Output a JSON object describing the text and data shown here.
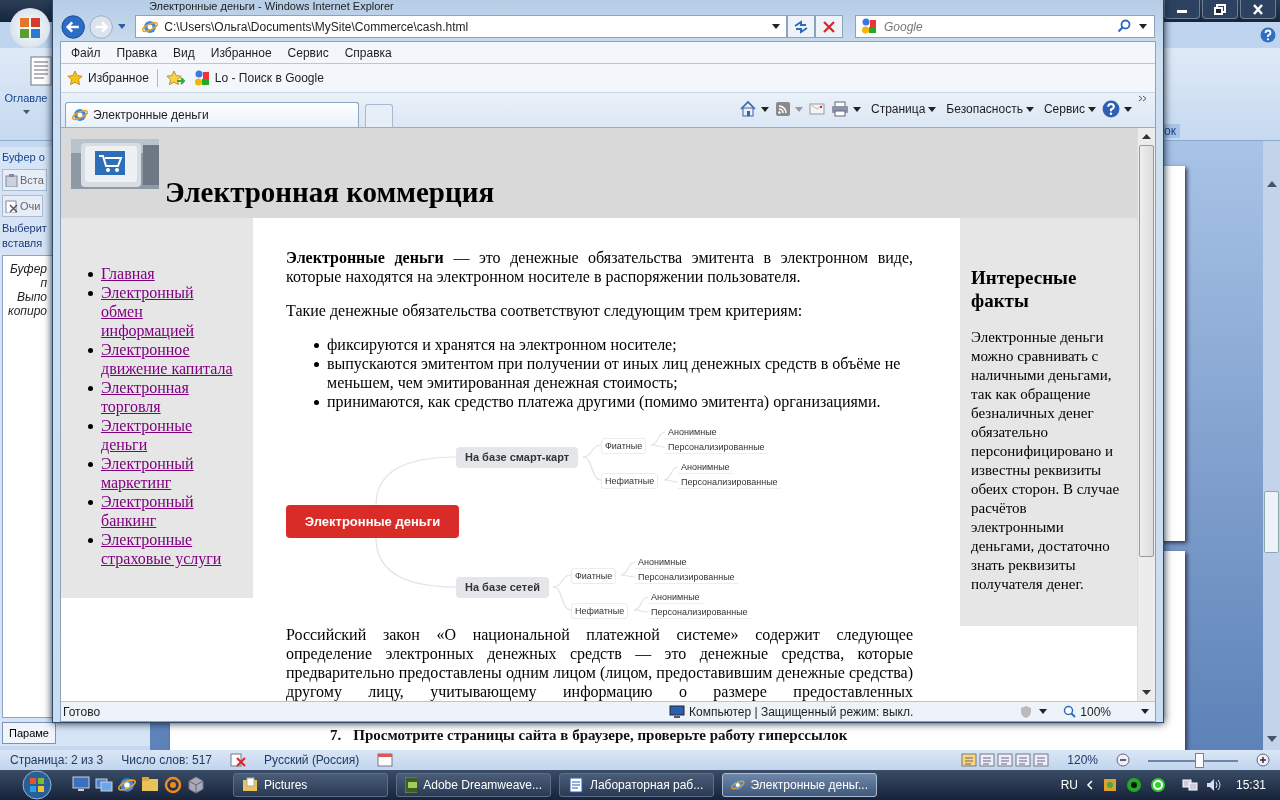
{
  "word": {
    "ribbon_group": "Оглавле",
    "ribbon_tail": "ок",
    "pane": {
      "title": "Буфер о",
      "paste": "Вста",
      "clear": "Очи",
      "hint": [
        "Выберит",
        "вставля"
      ],
      "notice": [
        "Буфер",
        "п",
        "Выпо",
        "копиро"
      ],
      "options": "Параме"
    },
    "doc_line": {
      "number": "7.",
      "text": "Просмотрите страницы сайта в браузере, проверьте работу гиперссылок"
    },
    "status": {
      "page": "Страница: 2 из 3",
      "words": "Число слов: 517",
      "language": "Русский (Россия)",
      "zoom": "120%",
      "zoom_slider": {
        "level": 0.55
      }
    }
  },
  "browser": {
    "title": "Электронные деньги - Windows Internet Explorer",
    "address": "C:\\Users\\Ольга\\Documents\\MySite\\Commerce\\cash.html",
    "search": {
      "placeholder": "Google"
    },
    "menu": [
      "Файл",
      "Правка",
      "Вид",
      "Избранное",
      "Сервис",
      "Справка"
    ],
    "favorites": "Избранное",
    "favorite_link": "Lo - Поиск в Google",
    "tabs": [
      {
        "label": "Электронные деньги",
        "selected": true
      }
    ],
    "commands": [
      "Страница",
      "Безопасность",
      "Сервис"
    ],
    "page": {
      "heading": "Электронная коммерция",
      "nav": [
        "Главная",
        "Электронный обмен информацией",
        "Электронное движение капитала",
        "Электронная торговля",
        "Электронные деньги",
        "Электронный маркетинг",
        "Электронный банкинг",
        "Электронные страховые услуги"
      ],
      "main": [
        {
          "kind": "paragraph",
          "text": "**Электронные деньги** — это денежные обязательства эмитента в электронном виде, которые находятся на электронном носителе в распоряжении пользователя."
        },
        {
          "kind": "paragraph",
          "text": "Такие денежные обязательства соответствуют следующим трем критериям:"
        },
        {
          "kind": "bullets",
          "items": [
            "фиксируются и хранятся на электронном носителе;",
            "выпускаются эмитентом при получении от иных лиц денежных средств в объёме не меньшем, чем эмитированная денежная стоимость;",
            "принимаются, как средство платежа другими (помимо эмитента) организациями."
          ]
        },
        {
          "kind": "mindmap",
          "root": {
            "label": "Электронные деньги",
            "children": [
              {
                "label": "На базе смарт-карт",
                "children": [
                  {
                    "label": "Фиатные",
                    "children": [
                      {
                        "label": "Анонимные"
                      },
                      {
                        "label": "Персонализированные"
                      }
                    ]
                  },
                  {
                    "label": "Нефиатные",
                    "children": [
                      {
                        "label": "Анонимные"
                      },
                      {
                        "label": "Персонализированные"
                      }
                    ]
                  }
                ]
              },
              {
                "label": "На базе сетей",
                "children": [
                  {
                    "label": "Фиатные",
                    "children": [
                      {
                        "label": "Анонимные"
                      },
                      {
                        "label": "Персонализированные"
                      }
                    ]
                  },
                  {
                    "label": "Нефиатные",
                    "children": [
                      {
                        "label": "Анонимные"
                      },
                      {
                        "label": "Персонализированные"
                      }
                    ]
                  }
                ]
              }
            ]
          }
        },
        {
          "kind": "paragraph",
          "text": "Российский закон «О национальной платежной системе» содержит следующее определение электронных денежных средств — это денежные средства, которые предварительно предоставлены одним лицом (лицом, предоставившим денежные средства) другому лицу, учитывающему информацию о размере предоставленных"
        }
      ],
      "aside": {
        "title": "Интересные факты",
        "text": "Электронные деньги можно сравнивать с наличными деньгами, так как обращение безналичных денег обязательно персонифицировано и известны реквизиты обеих сторон. В случае расчётов электронными деньгами, достаточно знать реквизиты получателя денег."
      }
    },
    "status": {
      "text": "Готово",
      "zone": "Компьютер | Защищенный режим: выкл.",
      "zoom": "100%"
    }
  },
  "taskbar": {
    "buttons": [
      {
        "label": "Pictures",
        "selected": false
      },
      {
        "label": "Adobe Dreamweave...",
        "selected": false
      },
      {
        "label": "Лабораторная раб...",
        "selected": false
      },
      {
        "label": "Электронные деньг...",
        "selected": true
      }
    ],
    "language": "RU",
    "clock": "15:31"
  }
}
